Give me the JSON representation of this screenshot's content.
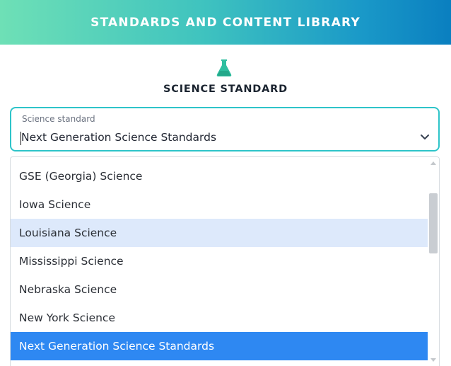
{
  "header": {
    "title": "STANDARDS AND CONTENT LIBRARY"
  },
  "section": {
    "icon": "flask-icon",
    "title": "SCIENCE STANDARD"
  },
  "select": {
    "label": "Science standard",
    "value": "Next Generation Science Standards"
  },
  "dropdown": {
    "options": [
      {
        "label": "GSE (Georgia) Science",
        "state": "normal"
      },
      {
        "label": "Iowa Science",
        "state": "normal"
      },
      {
        "label": "Louisiana Science",
        "state": "hover"
      },
      {
        "label": "Mississippi Science",
        "state": "normal"
      },
      {
        "label": "Nebraska Science",
        "state": "normal"
      },
      {
        "label": "New York Science",
        "state": "normal"
      },
      {
        "label": "Next Generation Science Standards",
        "state": "selected"
      }
    ]
  },
  "colors": {
    "header_gradient_start": "#6ee0b6",
    "header_gradient_end": "#0a7fc0",
    "accent_teal": "#2ec4c9",
    "hover_bg": "#dde9fb",
    "selected_bg": "#2e88f2"
  }
}
